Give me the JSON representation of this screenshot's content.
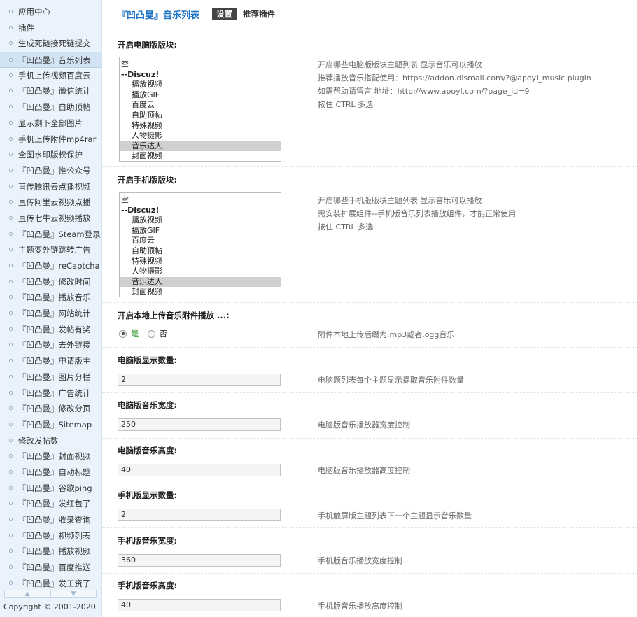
{
  "sidebar": {
    "items": [
      {
        "label": "应用中心",
        "active": false
      },
      {
        "label": "插件",
        "active": false
      },
      {
        "label": "生成死链接死链提交",
        "active": false
      },
      {
        "label": "『凹凸曼』音乐列表",
        "active": true
      },
      {
        "label": "手机上传视频百度云",
        "active": false
      },
      {
        "label": "『凹凸曼』微信统计",
        "active": false
      },
      {
        "label": "『凹凸曼』自助顶帖",
        "active": false
      },
      {
        "label": "显示剩下全部图片",
        "active": false
      },
      {
        "label": "手机上传附件mp4rar",
        "active": false
      },
      {
        "label": "全图水印版权保护",
        "active": false
      },
      {
        "label": "『凹凸曼』推公众号",
        "active": false
      },
      {
        "label": "直传腾讯云点播视频",
        "active": false
      },
      {
        "label": "直传阿里云视频点播",
        "active": false
      },
      {
        "label": "直传七牛云视频播放",
        "active": false
      },
      {
        "label": "『凹凸曼』Steam登录",
        "active": false
      },
      {
        "label": "主题变外链跳转广告",
        "active": false
      },
      {
        "label": "『凹凸曼』reCaptcha",
        "active": false
      },
      {
        "label": "『凹凸曼』修改时间",
        "active": false
      },
      {
        "label": "『凹凸曼』播放音乐",
        "active": false
      },
      {
        "label": "『凹凸曼』网站统计",
        "active": false
      },
      {
        "label": "『凹凸曼』发帖有奖",
        "active": false
      },
      {
        "label": "『凹凸曼』去外链接",
        "active": false
      },
      {
        "label": "『凹凸曼』申请版主",
        "active": false
      },
      {
        "label": "『凹凸曼』图片分栏",
        "active": false
      },
      {
        "label": "『凹凸曼』广告统计",
        "active": false
      },
      {
        "label": "『凹凸曼』修改分页",
        "active": false
      },
      {
        "label": "『凹凸曼』Sitemap",
        "active": false
      },
      {
        "label": "修改发帖数",
        "active": false
      },
      {
        "label": "『凹凸曼』封面视频",
        "active": false
      },
      {
        "label": "『凹凸曼』自动标题",
        "active": false
      },
      {
        "label": "『凹凸曼』谷歌ping",
        "active": false
      },
      {
        "label": "『凹凸曼』发红包了",
        "active": false
      },
      {
        "label": "『凹凸曼』收录查询",
        "active": false
      },
      {
        "label": "『凹凸曼』视频列表",
        "active": false
      },
      {
        "label": "『凹凸曼』播放视频",
        "active": false
      },
      {
        "label": "『凹凸曼』百度推送",
        "active": false
      },
      {
        "label": "『凹凸曼』发工资了",
        "active": false
      }
    ],
    "scroll_up": "▲",
    "scroll_down": "▼",
    "copyright": "Copyright © 2001-2020"
  },
  "header": {
    "plugin_title": "『凹凸曼』音乐列表",
    "tab_settings": "设置",
    "tab_recommend": "推荐插件"
  },
  "settings": {
    "pc_forums": {
      "title": "开启电脑版版块:",
      "options": [
        {
          "label": "空",
          "kind": "root",
          "selected": false
        },
        {
          "label": "--Discuz!",
          "kind": "group",
          "selected": false
        },
        {
          "label": "播放视频",
          "kind": "child",
          "selected": false
        },
        {
          "label": "播放GIF",
          "kind": "child",
          "selected": false
        },
        {
          "label": "百度云",
          "kind": "child",
          "selected": false
        },
        {
          "label": "自助顶帖",
          "kind": "child",
          "selected": false
        },
        {
          "label": "特殊视频",
          "kind": "child",
          "selected": false
        },
        {
          "label": "人物摄影",
          "kind": "child",
          "selected": false
        },
        {
          "label": "音乐达人",
          "kind": "child",
          "selected": true
        },
        {
          "label": "封面视频",
          "kind": "child",
          "selected": false
        }
      ],
      "help": [
        "开启哪些电脑版版块主题列表 显示音乐可以播放",
        "推荐播放音乐搭配使用：https://addon.dismall.com/?@apoyl_music.plugin",
        "如需帮助请留言 地址：http://www.apoyl.com/?page_id=9",
        "按住 CTRL 多选"
      ]
    },
    "mobile_forums": {
      "title": "开启手机版版块:",
      "options": [
        {
          "label": "空",
          "kind": "root",
          "selected": false
        },
        {
          "label": "--Discuz!",
          "kind": "group",
          "selected": false
        },
        {
          "label": "播放视频",
          "kind": "child",
          "selected": false
        },
        {
          "label": "播放GIF",
          "kind": "child",
          "selected": false
        },
        {
          "label": "百度云",
          "kind": "child",
          "selected": false
        },
        {
          "label": "自助顶帖",
          "kind": "child",
          "selected": false
        },
        {
          "label": "特殊视频",
          "kind": "child",
          "selected": false
        },
        {
          "label": "人物摄影",
          "kind": "child",
          "selected": false
        },
        {
          "label": "音乐达人",
          "kind": "child",
          "selected": true
        },
        {
          "label": "封面视频",
          "kind": "child",
          "selected": false
        }
      ],
      "help": [
        "开启哪些手机版版块主题列表 显示音乐可以播放",
        "需安装扩展组件--手机版音乐列表播放组件，才能正常使用",
        "按住 CTRL 多选"
      ]
    },
    "local_upload": {
      "title": "开启本地上传音乐附件播放 ...:",
      "yes_label": "是",
      "no_label": "否",
      "value": "yes",
      "help": "附件本地上传后缀为.mp3或者.ogg音乐"
    },
    "pc_count": {
      "title": "电脑版显示数量:",
      "value": "2",
      "help": "电脑题列表每个主题显示提取音乐附件数量"
    },
    "pc_width": {
      "title": "电脑版音乐宽度:",
      "value": "250",
      "help": "电脑版音乐播放器宽度控制"
    },
    "pc_height": {
      "title": "电脑版音乐高度:",
      "value": "40",
      "help": "电脑版音乐播放器高度控制"
    },
    "mobile_count": {
      "title": "手机版显示数量:",
      "value": "2",
      "help": "手机触屏版主题列表下一个主题显示音乐数量"
    },
    "mobile_width": {
      "title": "手机版音乐宽度:",
      "value": "360",
      "help": "手机版音乐播放宽度控制"
    },
    "mobile_height": {
      "title": "手机版音乐高度:",
      "value": "40",
      "help": "手机版音乐播放高度控制"
    }
  }
}
